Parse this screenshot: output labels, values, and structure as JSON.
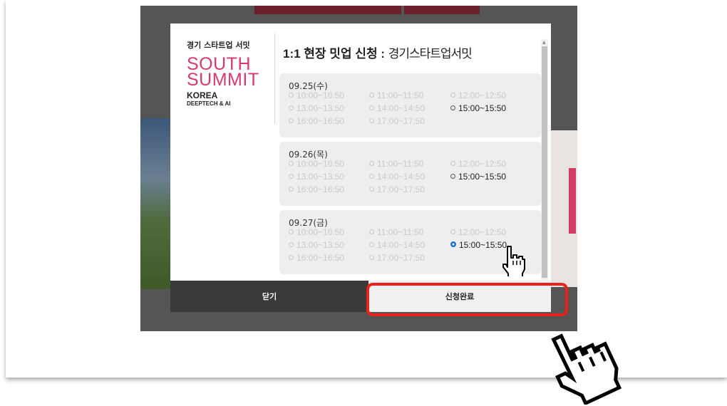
{
  "brand": {
    "subtitle": "경기 스타트업 서밋",
    "south": "SOUTH",
    "summit": "SUMMIT",
    "korea": "KOREA",
    "deeptech": "DEEPTECH & AI"
  },
  "modal": {
    "title": "1:1 현장 밋업 신청 : ",
    "title_suffix": "경기스타트업서밋"
  },
  "days": [
    {
      "date": "09.25(수)",
      "slots": [
        {
          "time": "10:00~10:50",
          "available": false,
          "checked": false
        },
        {
          "time": "11:00~11:50",
          "available": false,
          "checked": false
        },
        {
          "time": "12:00~12:50",
          "available": false,
          "checked": false
        },
        {
          "time": "13:00~13:50",
          "available": false,
          "checked": false
        },
        {
          "time": "14:00~14:50",
          "available": false,
          "checked": false
        },
        {
          "time": "15:00~15:50",
          "available": true,
          "checked": false
        },
        {
          "time": "16:00~16:50",
          "available": false,
          "checked": false
        },
        {
          "time": "17:00~17:50",
          "available": false,
          "checked": false
        }
      ]
    },
    {
      "date": "09.26(목)",
      "slots": [
        {
          "time": "10:00~10:50",
          "available": false,
          "checked": false
        },
        {
          "time": "11:00~11:50",
          "available": false,
          "checked": false
        },
        {
          "time": "12:00~12:50",
          "available": false,
          "checked": false
        },
        {
          "time": "13:00~13:50",
          "available": false,
          "checked": false
        },
        {
          "time": "14:00~14:50",
          "available": false,
          "checked": false
        },
        {
          "time": "15:00~15:50",
          "available": true,
          "checked": false
        },
        {
          "time": "16:00~16:50",
          "available": false,
          "checked": false
        },
        {
          "time": "17:00~17:50",
          "available": false,
          "checked": false
        }
      ]
    },
    {
      "date": "09.27(금)",
      "slots": [
        {
          "time": "10:00~10:50",
          "available": false,
          "checked": false
        },
        {
          "time": "11:00~11:50",
          "available": false,
          "checked": false
        },
        {
          "time": "12:00~12:50",
          "available": false,
          "checked": false
        },
        {
          "time": "13:00~13:50",
          "available": false,
          "checked": false
        },
        {
          "time": "14:00~14:50",
          "available": false,
          "checked": false
        },
        {
          "time": "15:00~15:50",
          "available": true,
          "checked": true
        },
        {
          "time": "16:00~16:50",
          "available": false,
          "checked": false
        },
        {
          "time": "17:00~17:50",
          "available": false,
          "checked": false
        }
      ]
    }
  ],
  "buttons": {
    "close_label": "닫기",
    "submit_label": "신청완료"
  },
  "icons": {
    "cursor": "hand-pointer-icon",
    "annotation_hand": "hand-pointer-icon"
  },
  "colors": {
    "brand_pink": "#d63c6b",
    "highlight_red": "#e8231c",
    "radio_checked": "#1a6fd6"
  }
}
